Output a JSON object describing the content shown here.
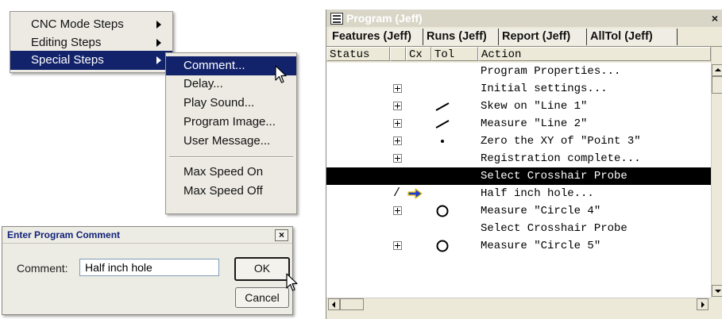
{
  "main_menu": {
    "items": [
      {
        "label": "CNC Mode Steps",
        "has_submenu": true,
        "selected": false
      },
      {
        "label": "Editing Steps",
        "has_submenu": true,
        "selected": false
      },
      {
        "label": "Special Steps",
        "has_submenu": true,
        "selected": true
      }
    ]
  },
  "special_steps_submenu": {
    "group1": [
      "Comment...",
      "Delay...",
      "Play Sound...",
      "Program Image...",
      "User Message..."
    ],
    "group2": [
      "Max Speed On",
      "Max Speed Off"
    ],
    "selected": "Comment..."
  },
  "comment_dialog": {
    "title": "Enter Program Comment",
    "close_label": "×",
    "field_label": "Comment:",
    "field_value": "Half inch hole",
    "ok_label": "OK",
    "cancel_label": "Cancel"
  },
  "program_window": {
    "title": "Program (Jeff)",
    "close_label": "×",
    "tabs": [
      "Features (Jeff)",
      "Runs (Jeff)",
      "Report (Jeff)",
      "AllTol (Jeff)"
    ],
    "columns": [
      "Status",
      "",
      "Cx",
      "Tol",
      "Action"
    ],
    "rows": [
      {
        "expand": false,
        "marker": "",
        "tol": "",
        "action": "Program Properties...",
        "selected": false
      },
      {
        "expand": true,
        "marker": "",
        "tol": "",
        "action": "Initial settings...",
        "selected": false
      },
      {
        "expand": true,
        "marker": "",
        "tol": "line",
        "action": "Skew on \"Line 1\"",
        "selected": false
      },
      {
        "expand": true,
        "marker": "",
        "tol": "line",
        "action": "Measure \"Line 2\"",
        "selected": false
      },
      {
        "expand": true,
        "marker": "",
        "tol": "point",
        "action": "Zero the XY of \"Point 3\"",
        "selected": false
      },
      {
        "expand": true,
        "marker": "",
        "tol": "",
        "action": "Registration complete...",
        "selected": false
      },
      {
        "expand": false,
        "marker": "",
        "tol": "",
        "action": "Select Crosshair Probe",
        "selected": true
      },
      {
        "expand": false,
        "marker": "/",
        "tol": "arrow",
        "action": "Half inch hole...",
        "selected": false
      },
      {
        "expand": true,
        "marker": "",
        "tol": "circle",
        "action": "Measure \"Circle 4\"",
        "selected": false
      },
      {
        "expand": false,
        "marker": "",
        "tol": "",
        "action": "Select Crosshair Probe",
        "selected": false
      },
      {
        "expand": true,
        "marker": "",
        "tol": "circle",
        "action": "Measure \"Circle 5\"",
        "selected": false
      }
    ]
  },
  "colors": {
    "menu_highlight": "#13236b",
    "dialog_title_text": "#11237a",
    "window_title_bg": "#d9d6c8",
    "current_step_arrow": "#1a3fd6",
    "current_step_arrow_outline": "#f2c200"
  }
}
